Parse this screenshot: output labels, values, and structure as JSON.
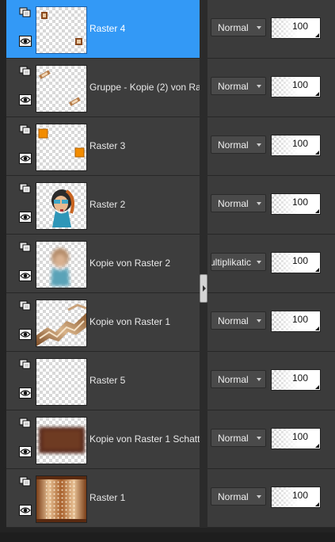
{
  "layers": [
    {
      "name": "Raster 4",
      "blend_mode": "Normal",
      "opacity": "100",
      "selected": true,
      "thumbnail": "raster4"
    },
    {
      "name": "Gruppe - Kopie (2) von Ras",
      "blend_mode": "Normal",
      "opacity": "100",
      "selected": false,
      "thumbnail": "gruppe-kopie"
    },
    {
      "name": "Raster 3",
      "blend_mode": "Normal",
      "opacity": "100",
      "selected": false,
      "thumbnail": "raster3"
    },
    {
      "name": "Raster 2",
      "blend_mode": "Normal",
      "opacity": "100",
      "selected": false,
      "thumbnail": "raster2"
    },
    {
      "name": "Kopie von Raster 2",
      "blend_mode": "lultiplikatic",
      "opacity": "100",
      "selected": false,
      "thumbnail": "kopie-raster2",
      "blend_clipped": true
    },
    {
      "name": "Kopie von Raster 1",
      "blend_mode": "Normal",
      "opacity": "100",
      "selected": false,
      "thumbnail": "kopie-raster1"
    },
    {
      "name": "Raster 5",
      "blend_mode": "Normal",
      "opacity": "100",
      "selected": false,
      "thumbnail": "raster5"
    },
    {
      "name": "Kopie von Raster 1 Schatte",
      "blend_mode": "Normal",
      "opacity": "100",
      "selected": false,
      "thumbnail": "schatten"
    },
    {
      "name": "Raster 1",
      "blend_mode": "Normal",
      "opacity": "100",
      "selected": false,
      "thumbnail": "raster1"
    }
  ],
  "icons": {
    "visibility": "layer-link-icon",
    "eye": "eye-icon",
    "collapse": "collapse-right-icon"
  },
  "colors": {
    "selected_row": "#3399f6",
    "row_bg": "#3d3d3d",
    "panel_bg": "#232323",
    "orange_accent": "#f28c00"
  }
}
